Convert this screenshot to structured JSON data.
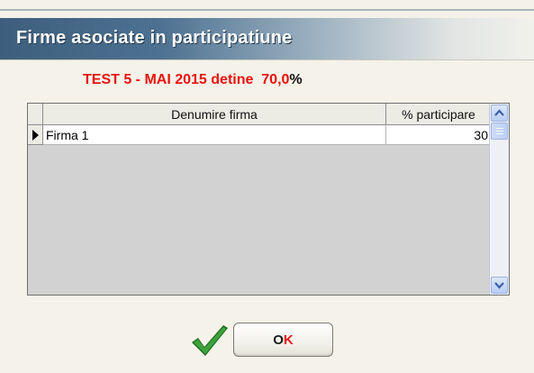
{
  "window": {
    "title": "Firme asociate in participatiune"
  },
  "headline": {
    "company": "TEST 5 - MAI 2015 detine",
    "percent_value": "70,0",
    "percent_sign": "%"
  },
  "grid": {
    "columns": [
      "Denumire firma",
      "% participare"
    ],
    "rows": [
      {
        "name": "Firma 1",
        "percent": "30"
      }
    ]
  },
  "ok_button": {
    "label_o": "O",
    "label_k": "K"
  },
  "icons": {
    "confirm": "checkmark-icon",
    "row_pointer": "row-pointer-icon",
    "scroll_up": "chevron-up-icon",
    "scroll_down": "chevron-down-icon"
  }
}
